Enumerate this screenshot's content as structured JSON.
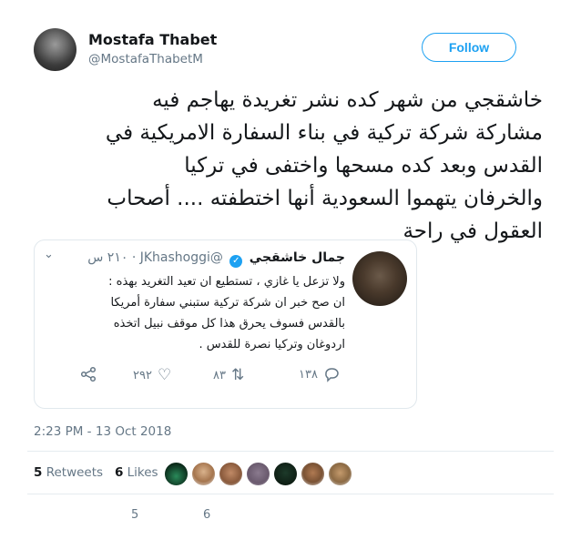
{
  "author": {
    "name": "Mostafa Thabet",
    "handle": "@MostafaThabetM"
  },
  "follow_label": "Follow",
  "tweet_lines": [
    "خاشقجي من شهر كده نشر تغريدة يهاجم فيه",
    "مشاركة شركة تركية في بناء السفارة الامريكية في",
    "القدس وبعد كده مسحها واختفى في تركيا",
    "والخرفان يتهموا السعودية أنها اختطفته .... أصحاب",
    "العقول في راحة"
  ],
  "quoted": {
    "name": "جمال خاشقجي",
    "handle": "@JKhashoggi",
    "time": "٢١٠ س",
    "lines": [
      "ولا تزعل يا غازي ، تستطيع ان تعيد التغريد بهذه :",
      "ان صح خبر ان شركة تركية ستبني سفارة أمريكا",
      "بالقدس فسوف يحرق هذا كل موقف نبيل اتخذه",
      "اردوغان وتركيا نصرة للقدس ."
    ],
    "replies": "١٣٨",
    "retweets": "٨٣",
    "likes": "٢٩٢"
  },
  "date": "2:23 PM - 13 Oct 2018",
  "stats": {
    "retweets_count": "5",
    "retweets_label": "Retweets",
    "likes_count": "6",
    "likes_label": "Likes"
  },
  "bottom_counts": {
    "retweets": "5",
    "likes": "6"
  },
  "icons": {
    "verified": "verified-badge-icon",
    "chevron": "chevron-down-icon",
    "share": "share-icon",
    "like": "heart-icon",
    "retweet": "retweet-icon",
    "reply": "reply-icon"
  },
  "colors": {
    "accent": "#1da1f2",
    "text": "#14171a",
    "muted": "#657786"
  }
}
